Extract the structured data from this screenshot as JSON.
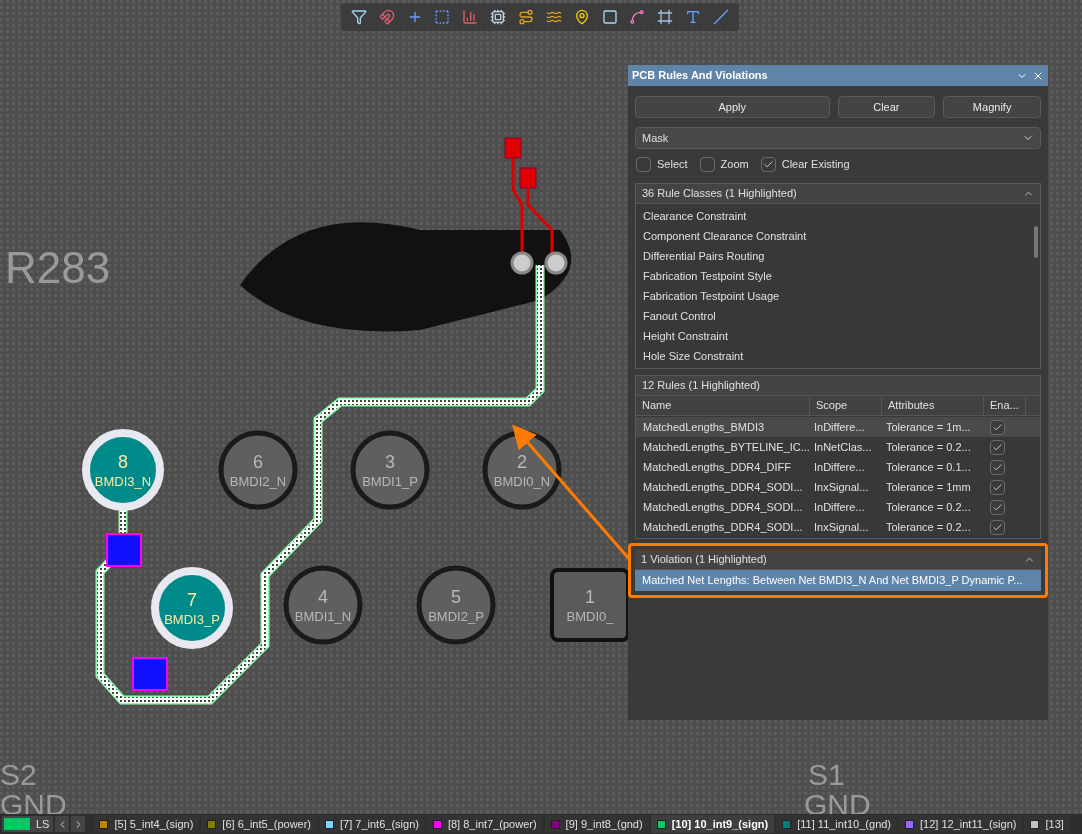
{
  "canvas": {
    "silkscreen": [
      "R283",
      "S2",
      "GND",
      "S1",
      "GND"
    ],
    "pads": [
      {
        "number": "8",
        "net": "BMDI3_N",
        "highlighted": true
      },
      {
        "number": "7",
        "net": "BMDI3_P",
        "highlighted": true
      },
      {
        "number": "6",
        "net": "BMDI2_N",
        "highlighted": false
      },
      {
        "number": "3",
        "net": "BMDI1_P",
        "highlighted": false
      },
      {
        "number": "2",
        "net": "BMDI0_N",
        "highlighted": false
      },
      {
        "number": "4",
        "net": "BMDI1_N",
        "highlighted": false
      },
      {
        "number": "5",
        "net": "BMDI2_P",
        "highlighted": false
      },
      {
        "number": "1",
        "net": "BMDI0_",
        "highlighted": false
      }
    ]
  },
  "panel": {
    "title": "PCB Rules And Violations",
    "buttons": [
      "Apply",
      "Clear",
      "Magnify"
    ],
    "mode": "Mask",
    "options": [
      {
        "label": "Select",
        "checked": false
      },
      {
        "label": "Zoom",
        "checked": false
      },
      {
        "label": "Clear Existing",
        "checked": true
      }
    ],
    "rule_classes": {
      "header": "36 Rule Classes (1 Highlighted)",
      "items": [
        "Clearance Constraint",
        "Component Clearance Constraint",
        "Differential Pairs Routing",
        "Fabrication Testpoint Style",
        "Fabrication Testpoint Usage",
        "Fanout Control",
        "Height Constraint",
        "Hole Size Constraint"
      ]
    },
    "rules": {
      "header": "12 Rules (1 Highlighted)",
      "columns": [
        "Name",
        "Scope",
        "Attributes",
        "Ena..."
      ],
      "rows": [
        {
          "name": "MatchedLengths_BMDI3",
          "scope": "InDiffere...",
          "attributes": "Tolerance = 1m...",
          "enabled": true,
          "selected": true
        },
        {
          "name": "MatchedLengths_BYTELINE_IC...",
          "scope": "InNetClas...",
          "attributes": "Tolerance = 0.2...",
          "enabled": true,
          "selected": false
        },
        {
          "name": "MatchedLengths_DDR4_DIFF",
          "scope": "InDiffere...",
          "attributes": "Tolerance = 0.1...",
          "enabled": true,
          "selected": false
        },
        {
          "name": "MatchedLengths_DDR4_SODI...",
          "scope": "InxSignal...",
          "attributes": "Tolerance = 1mm",
          "enabled": true,
          "selected": false
        },
        {
          "name": "MatchedLengths_DDR4_SODI...",
          "scope": "InDiffere...",
          "attributes": "Tolerance = 0.2...",
          "enabled": true,
          "selected": false
        },
        {
          "name": "MatchedLengths_DDR4_SODI...",
          "scope": "InxSignal...",
          "attributes": "Tolerance = 0.2...",
          "enabled": true,
          "selected": false
        }
      ]
    },
    "violations": {
      "header": "1 Violation (1 Highlighted)",
      "items": [
        {
          "text": "Matched Net Lengths: Between Net BMDI3_N And Net BMDI3_P Dynamic P...",
          "selected": true
        }
      ]
    }
  },
  "layer_bar": {
    "current": {
      "label": "LS",
      "color": "#00c864"
    },
    "layers": [
      {
        "label": "[5] 5_int4_(sign)",
        "color": "#b8860b",
        "selected": false
      },
      {
        "label": "[6] 6_int5_(power)",
        "color": "#808000",
        "selected": false
      },
      {
        "label": "[7] 7_int6_(sign)",
        "color": "#7fd4ff",
        "selected": false
      },
      {
        "label": "[8] 8_int7_(power)",
        "color": "#ff00ff",
        "selected": false
      },
      {
        "label": "[9] 9_int8_(gnd)",
        "color": "#800080",
        "selected": false
      },
      {
        "label": "[10] 10_int9_(sign)",
        "color": "#00c864",
        "selected": true
      },
      {
        "label": "[11] 11_int10_(gnd)",
        "color": "#008080",
        "selected": false
      },
      {
        "label": "[12] 12_int11_(sign)",
        "color": "#9966ff",
        "selected": false
      },
      {
        "label": "[13]",
        "color": "#c0c0c0",
        "selected": false
      }
    ]
  }
}
